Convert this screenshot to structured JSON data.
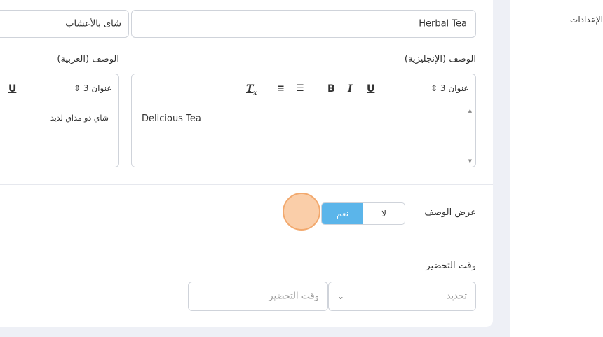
{
  "settings_label": "الإعدادات",
  "name_fields": {
    "english_value": "Herbal Tea",
    "arabic_value": "شاى بالأعشاب"
  },
  "description": {
    "english_label": "الوصف (الإنجليزية)",
    "arabic_label": "الوصف (العربية)",
    "english_content": "Delicious Tea",
    "arabic_content": "شاي ذو مذاق لذيذ",
    "heading_select": "عنوان 3",
    "heading_select_ar": "عنوان 3"
  },
  "show_description": {
    "label": "عرض الوصف",
    "yes": "نعم",
    "no": "لا",
    "selected": "نعم"
  },
  "prep_time": {
    "label": "وقت التحضير",
    "unit_placeholder": "تحديد",
    "value_placeholder": "وقت التحضير"
  },
  "colors": {
    "accent": "#5bb5ea",
    "border": "#cfd3da"
  }
}
